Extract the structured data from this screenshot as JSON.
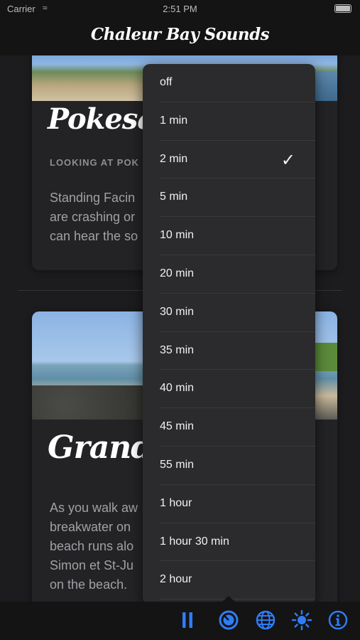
{
  "status_bar": {
    "carrier": "Carrier",
    "time": "2:51 PM"
  },
  "header": {
    "title": "Chaleur Bay Sounds"
  },
  "cards": [
    {
      "title": "Pokesaw B",
      "subtitle": "LOOKING AT POK",
      "text": "Standing Facin\nare crashing or\ncan hear the so"
    },
    {
      "title": "Grande-F",
      "text": "As you walk aw\nbreakwater on\nbeach runs alo\nSimon et St-Ju\non the beach."
    }
  ],
  "timer_menu": {
    "selected": "2 min",
    "options": [
      "off",
      "1 min",
      "2 min",
      "5 min",
      "10 min",
      "20 min",
      "30 min",
      "35 min",
      "40 min",
      "45 min",
      "55 min",
      "1 hour",
      "1 hour 30 min",
      "2 hour"
    ]
  },
  "tab_bar": {
    "items": [
      {
        "name": "pause-icon"
      },
      {
        "name": "timer-icon",
        "active": true
      },
      {
        "name": "globe-icon"
      },
      {
        "name": "brightness-icon"
      },
      {
        "name": "info-icon"
      }
    ],
    "accent": "#2f7cf6"
  }
}
